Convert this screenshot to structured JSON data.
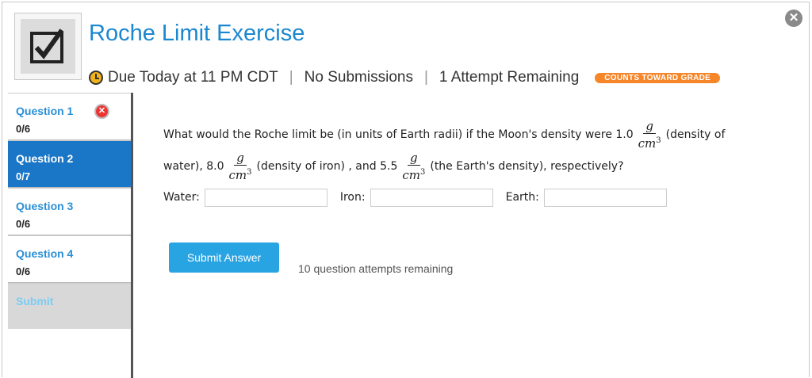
{
  "header": {
    "title": "Roche Limit Exercise",
    "due": "Due Today at 11 PM CDT",
    "sep1": "|",
    "submissions": "No Submissions",
    "sep2": "|",
    "attempts": "1 Attempt Remaining",
    "grade_badge": "COUNTS TOWARD GRADE",
    "close_glyph": "✕"
  },
  "sidebar": {
    "items": [
      {
        "label": "Question 1",
        "score": "0/6",
        "error_glyph": "✕"
      },
      {
        "label": "Question 2",
        "score": "0/7"
      },
      {
        "label": "Question 3",
        "score": "0/6"
      },
      {
        "label": "Question 4",
        "score": "0/6"
      }
    ],
    "submit_label": "Submit"
  },
  "question": {
    "part1": "What would the Roche limit be (in units of Earth radii) if the Moon's density were 1.0",
    "part2": "(density of",
    "part3": "water), 8.0",
    "part4": "(density of iron) , and 5.5",
    "part5": "(the Earth's density), respectively?",
    "unit_num": "g",
    "unit_den": "cm",
    "unit_exp": "3",
    "fields": [
      {
        "label": "Water:",
        "value": ""
      },
      {
        "label": "Iron:",
        "value": ""
      },
      {
        "label": "Earth:",
        "value": ""
      }
    ]
  },
  "submit_button": "Submit Answer",
  "attempts_note": "10 question attempts remaining",
  "colors": {
    "accent": "#1a87cf",
    "active_tab": "#1a76c6",
    "badge": "#f5862a",
    "button": "#28a4e3"
  },
  "icons": {
    "assignment": "assignment-icon",
    "clock": "clock-icon",
    "close": "close-icon",
    "error": "error-icon"
  }
}
